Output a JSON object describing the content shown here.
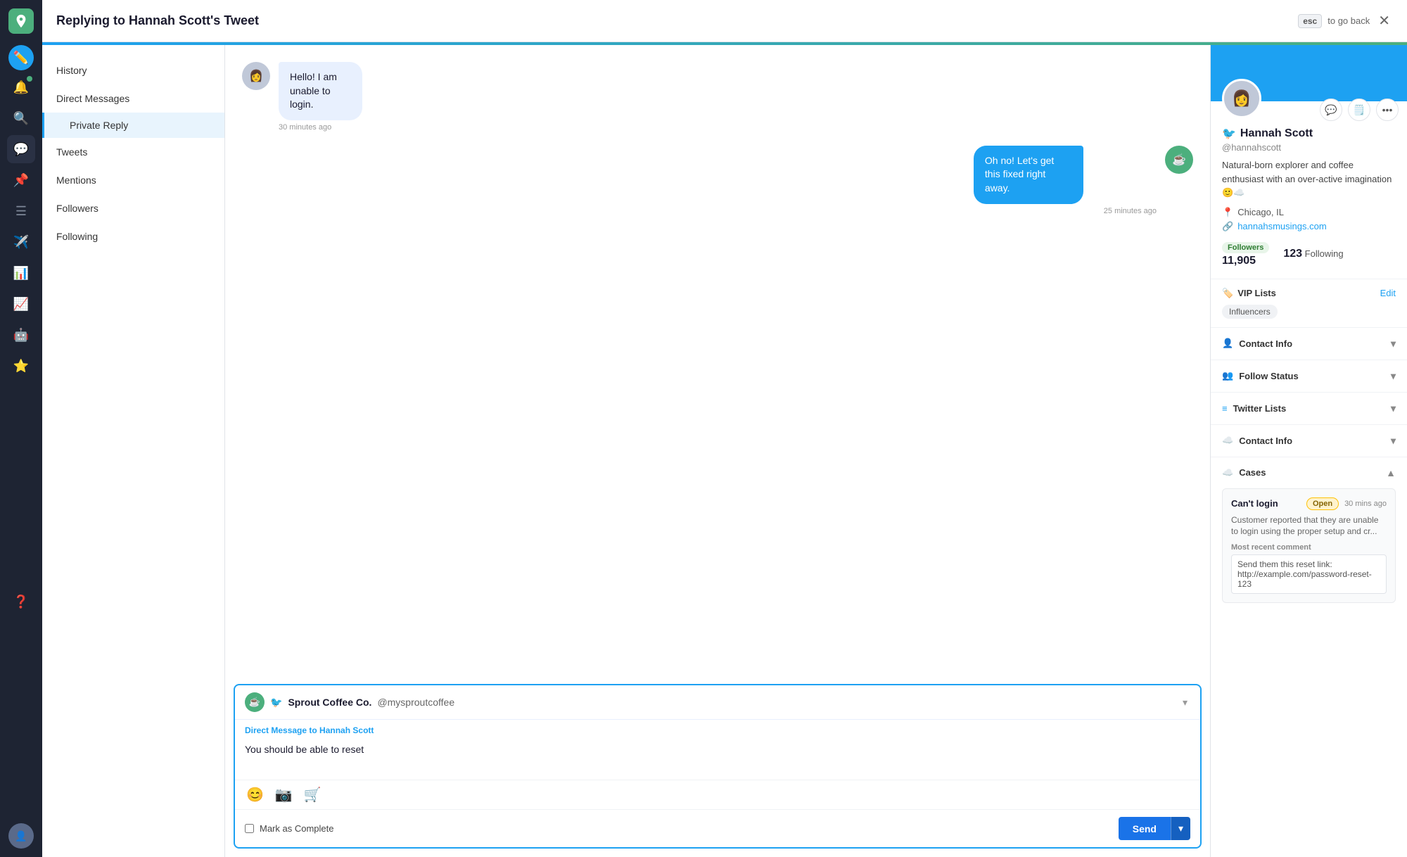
{
  "app": {
    "title": "Replying to Hannah Scott's Tweet",
    "esc_label": "esc",
    "go_back_label": "to go back"
  },
  "nav": {
    "items": [
      {
        "name": "compose",
        "icon": "✏️",
        "active": false
      },
      {
        "name": "notifications",
        "icon": "🔔",
        "active": false,
        "badge": true
      },
      {
        "name": "search",
        "icon": "🔍",
        "active": false
      },
      {
        "name": "inbox",
        "icon": "💬",
        "active": true
      },
      {
        "name": "pin",
        "icon": "📌",
        "active": false
      },
      {
        "name": "list",
        "icon": "☰",
        "active": false
      },
      {
        "name": "send",
        "icon": "✈️",
        "active": false
      },
      {
        "name": "chart",
        "icon": "📊",
        "active": false
      },
      {
        "name": "bar-chart",
        "icon": "📈",
        "active": false
      },
      {
        "name": "bot",
        "icon": "🤖",
        "active": false
      },
      {
        "name": "star",
        "icon": "⭐",
        "active": false
      },
      {
        "name": "help",
        "icon": "❓",
        "active": false
      }
    ]
  },
  "left_panel": {
    "items": [
      {
        "label": "History",
        "active": false
      },
      {
        "label": "Direct Messages",
        "active": false
      },
      {
        "label": "Private Reply",
        "sub": true,
        "active": true
      },
      {
        "label": "Tweets",
        "active": false
      },
      {
        "label": "Mentions",
        "active": false
      },
      {
        "label": "Followers",
        "active": false
      },
      {
        "label": "Following",
        "active": false
      }
    ]
  },
  "conversation": {
    "incoming_message": "Hello! I am unable to login.",
    "incoming_time": "30 minutes ago",
    "outgoing_message": "Oh no! Let's get this fixed right away.",
    "outgoing_time": "25 minutes ago"
  },
  "reply_box": {
    "sender_name": "Sprout Coffee Co.",
    "sender_handle": "@mysproutcoffee",
    "reply_to_label": "Direct Message to",
    "reply_to_name": "Hannah Scott",
    "reply_text": "You should be able to reset",
    "mark_complete_label": "Mark as Complete",
    "send_label": "Send"
  },
  "profile": {
    "name": "Hannah Scott",
    "handle": "@hannahscott",
    "bio": "Natural-born explorer and coffee enthusiast with an over-active imagination 🙂☁️",
    "location": "Chicago, IL",
    "website": "hannahsmusings.com",
    "website_url": "hannahsmusings.com",
    "followers_label": "Followers",
    "followers_count": "11,905",
    "following_count": "123",
    "following_label": "Following",
    "vip_lists_label": "VIP Lists",
    "vip_edit_label": "Edit",
    "vip_tag": "Influencers",
    "contact_info_label": "Contact Info",
    "follow_status_label": "Follow Status",
    "twitter_lists_label": "Twitter Lists",
    "sf_contact_info_label": "Contact Info",
    "cases_label": "Cases"
  },
  "cases": {
    "title": "Can't login",
    "badge": "Open",
    "time": "30 mins ago",
    "description": "Customer reported that they are unable to login using the proper setup and cr...",
    "comment_label": "Most recent comment",
    "comment_text": "Send them this reset link: http://example.com/password-reset-123"
  }
}
